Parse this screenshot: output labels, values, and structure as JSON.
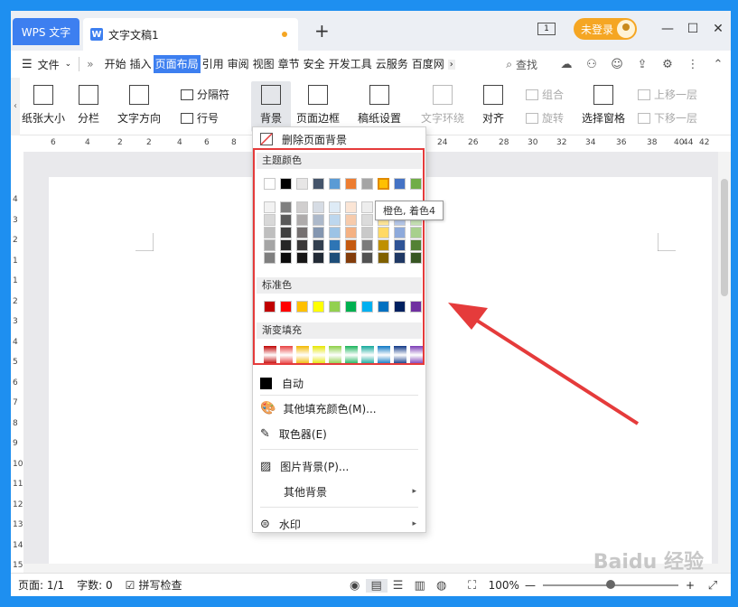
{
  "titlebar": {
    "app_tab": "WPS 文字",
    "doc_tab": "文字文稿1",
    "doc_icon": "W",
    "new_tab": "+",
    "window_count": "1",
    "login": "未登录",
    "minimize": "—",
    "maximize": "☐",
    "close": "✕"
  },
  "menubar": {
    "file": "文件",
    "items": [
      "开始",
      "插入",
      "页面布局",
      "引用",
      "审阅",
      "视图",
      "章节",
      "安全",
      "开发工具",
      "云服务",
      "百度网"
    ],
    "active": "页面布局",
    "search": "查找"
  },
  "ribbon": {
    "paper_size": "纸张大小",
    "columns": "分栏",
    "text_direction": "文字方向",
    "separator": "分隔符",
    "line_number": "行号",
    "background": "背景",
    "page_border": "页面边框",
    "manuscript": "稿纸设置",
    "text_wrap": "文字环绕",
    "align": "对齐",
    "group": "组合",
    "rotate": "旋转",
    "selection_pane": "选择窗格",
    "bring_forward": "上移一层",
    "send_backward": "下移一层"
  },
  "ruler_h": [
    "6",
    "4",
    "2",
    "2",
    "4",
    "6",
    "8",
    "22",
    "24",
    "26",
    "28",
    "30",
    "32",
    "34",
    "36",
    "38",
    "40",
    "42",
    "44"
  ],
  "ruler_v": [
    "4",
    "3",
    "2",
    "1",
    "1",
    "2",
    "3",
    "4",
    "5",
    "6",
    "7",
    "8",
    "9",
    "10",
    "11",
    "12",
    "13",
    "14",
    "15"
  ],
  "dropdown": {
    "remove_bg": "删除页面背景",
    "theme_colors": "主题颜色",
    "standard_colors": "标准色",
    "gradient_fill": "渐变填充",
    "auto": "自动",
    "more_fill": "其他填充颜色(M)...",
    "picker": "取色器(E)",
    "image_bg": "图片背景(P)...",
    "other_bg": "其他背景",
    "watermark": "水印",
    "tooltip": "橙色, 着色4",
    "theme_top": [
      "#ffffff",
      "#000000",
      "#e7e6e6",
      "#44546a",
      "#5b9bd5",
      "#ed7d31",
      "#a5a5a5",
      "#ffc000",
      "#4472c4",
      "#70ad47"
    ],
    "theme_shades": [
      [
        "#f2f2f2",
        "#7f7f7f",
        "#d0cece",
        "#d6dce4",
        "#deebf6",
        "#fbe5d5",
        "#ededed",
        "#fff2cc",
        "#dae3f3",
        "#e2efd9"
      ],
      [
        "#d8d8d8",
        "#595959",
        "#aeabab",
        "#adb9ca",
        "#bdd7ee",
        "#f7cbac",
        "#dbdbdb",
        "#fee599",
        "#b4c6e7",
        "#c5e0b3"
      ],
      [
        "#bfbfbf",
        "#3f3f3f",
        "#757070",
        "#8496b0",
        "#9cc3e5",
        "#f4b183",
        "#c9c9c9",
        "#ffd965",
        "#8eaadb",
        "#a8d08d"
      ],
      [
        "#a5a5a5",
        "#262626",
        "#3a3838",
        "#323f4f",
        "#2e75b5",
        "#c55a11",
        "#7b7b7b",
        "#bf9000",
        "#2f5496",
        "#538135"
      ],
      [
        "#7f7f7f",
        "#0c0c0c",
        "#171616",
        "#222a35",
        "#1e4e79",
        "#833c0b",
        "#525252",
        "#7f6000",
        "#1f3864",
        "#375623"
      ]
    ],
    "standard": [
      "#c00000",
      "#ff0000",
      "#ffc000",
      "#ffff00",
      "#92d050",
      "#00b050",
      "#00b0f0",
      "#0070c0",
      "#002060",
      "#7030a0"
    ],
    "gradient": [
      "#c00000",
      "#e84040",
      "#f2b800",
      "#e6e600",
      "#8ccf46",
      "#19b35a",
      "#12a89a",
      "#0b76c4",
      "#0d3585",
      "#7a3ab5"
    ]
  },
  "status": {
    "page": "页面: 1/1",
    "words": "字数: 0",
    "spell": "拼写检查",
    "zoom": "100%",
    "watermark_text": "Baidu 经验"
  }
}
